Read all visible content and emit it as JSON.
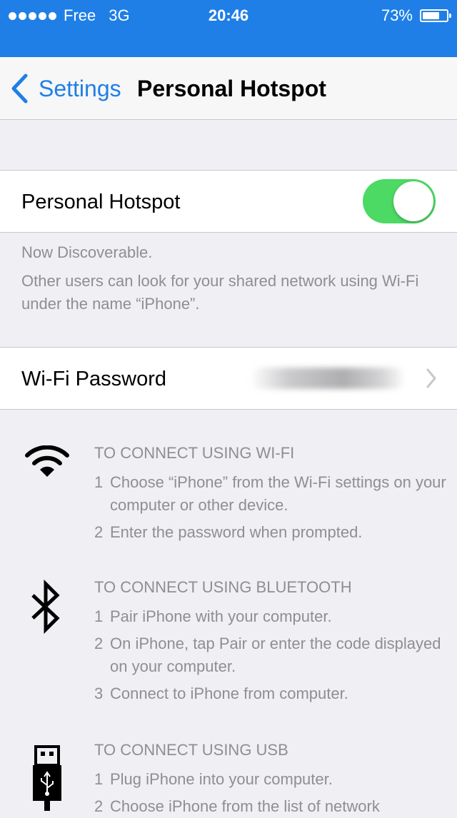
{
  "status_bar": {
    "carrier": "Free",
    "network": "3G",
    "time": "20:46",
    "battery_percent": "73%",
    "battery_level": 0.73
  },
  "nav": {
    "back_label": "Settings",
    "title": "Personal Hotspot"
  },
  "hotspot": {
    "label": "Personal Hotspot",
    "enabled": true,
    "discoverable": "Now Discoverable.",
    "description": "Other users can look for your shared network using Wi-Fi under the name “iPhone”."
  },
  "password": {
    "label": "Wi-Fi Password"
  },
  "instructions": {
    "wifi": {
      "heading": "TO CONNECT USING WI-FI",
      "steps": [
        {
          "num": "1",
          "text": "Choose “iPhone” from the Wi-Fi settings on your computer or other device."
        },
        {
          "num": "2",
          "text": "Enter the password when prompted."
        }
      ]
    },
    "bluetooth": {
      "heading": "TO CONNECT USING BLUETOOTH",
      "steps": [
        {
          "num": "1",
          "text": "Pair iPhone with your computer."
        },
        {
          "num": "2",
          "text": "On iPhone, tap Pair or enter the code displayed on your computer."
        },
        {
          "num": "3",
          "text": "Connect to iPhone from computer."
        }
      ]
    },
    "usb": {
      "heading": "TO CONNECT USING USB",
      "steps": [
        {
          "num": "1",
          "text": "Plug iPhone into your computer."
        },
        {
          "num": "2",
          "text": "Choose iPhone from the list of network"
        }
      ]
    }
  },
  "colors": {
    "accent": "#1f7fe6",
    "toggle_on": "#4cd964",
    "secondary_text": "#8e8e93",
    "background": "#efeff4"
  },
  "icons": [
    "back-chevron-icon",
    "wifi-icon",
    "bluetooth-icon",
    "usb-icon",
    "chevron-right-icon"
  ]
}
